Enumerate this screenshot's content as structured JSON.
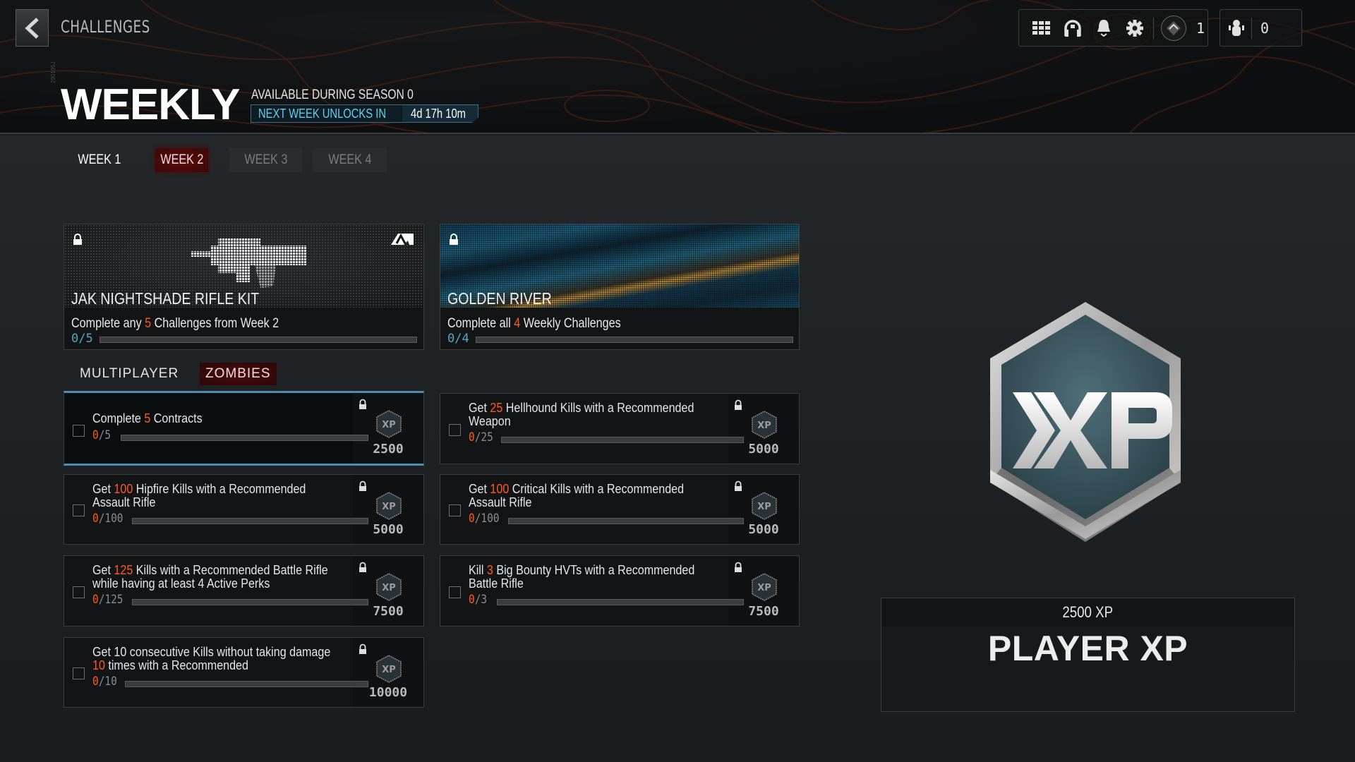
{
  "header": {
    "breadcrumb": "CHALLENGES",
    "side_code": "290195J",
    "title": "WEEKLY",
    "availability": "AVAILABLE DURING SEASON 0",
    "timer_label": "NEXT WEEK UNLOCKS IN",
    "timer_value": "4d 17h 10m"
  },
  "topbar": {
    "icons": [
      "grid-icon",
      "headset-icon",
      "bell-icon",
      "gear-icon"
    ],
    "rank_value": "1",
    "party_count": "0"
  },
  "weeks": [
    {
      "label": "WEEK 1",
      "state": "done"
    },
    {
      "label": "WEEK 2",
      "state": "active"
    },
    {
      "label": "WEEK 3",
      "state": "locked"
    },
    {
      "label": "WEEK 4",
      "state": "locked"
    }
  ],
  "rewards": [
    {
      "name": "JAK NIGHTSHADE RIFLE KIT",
      "desc_pre": "Complete any ",
      "desc_num": "5",
      "desc_post": " Challenges from Week 2",
      "progress": "0/5",
      "current": 0,
      "total": 5
    },
    {
      "name": "GOLDEN RIVER",
      "desc_pre": "Complete all ",
      "desc_num": "4",
      "desc_post": " Weekly Challenges",
      "progress": "0/4",
      "current": 0,
      "total": 4
    }
  ],
  "modes": [
    {
      "label": "MULTIPLAYER",
      "active": false
    },
    {
      "label": "ZOMBIES",
      "active": true
    }
  ],
  "challenges": [
    {
      "pre": "Complete ",
      "num": "5",
      "post": " Contracts",
      "current": "0",
      "total": "/5",
      "progress_fraction": 0,
      "xp": "2500",
      "selected": true
    },
    {
      "pre": "Get ",
      "num": "25",
      "post": " Hellhound Kills with a Recommended Weapon",
      "current": "0",
      "total": "/25",
      "progress_fraction": 0,
      "xp": "5000",
      "selected": false
    },
    {
      "pre": "Get ",
      "num": "100",
      "post": " Hipfire Kills with a Recommended Assault Rifle",
      "current": "0",
      "total": "/100",
      "progress_fraction": 0,
      "xp": "5000",
      "selected": false
    },
    {
      "pre": "Get ",
      "num": "100",
      "post": " Critical Kills with a Recommended Assault Rifle",
      "current": "0",
      "total": "/100",
      "progress_fraction": 0,
      "xp": "5000",
      "selected": false
    },
    {
      "pre": "Get ",
      "num": "125",
      "post": " Kills with a Recommended Battle Rifle while having at least 4 Active Perks",
      "current": "0",
      "total": "/125",
      "progress_fraction": 0,
      "xp": "7500",
      "selected": false
    },
    {
      "pre": "Kill ",
      "num": "3",
      "post": " Big Bounty HVTs with a Recommended Battle Rifle",
      "current": "0",
      "total": "/3",
      "progress_fraction": 0,
      "xp": "7500",
      "selected": false
    },
    {
      "pre": "Get 10 consecutive Kills without taking damage ",
      "num": "10",
      "post": " times with a Recommended",
      "current": "0",
      "total": "/10",
      "progress_fraction": 0,
      "xp": "10000",
      "selected": false
    }
  ],
  "reward_panel": {
    "badge_text": "XP",
    "amount": "2500 XP",
    "label": "PLAYER XP"
  },
  "colors": {
    "accent_orange": "#ff5a1f",
    "accent_blue": "#4b8db3",
    "timer_cyan": "#5fd3f5",
    "active_tab_red": "#5a0c0c"
  }
}
